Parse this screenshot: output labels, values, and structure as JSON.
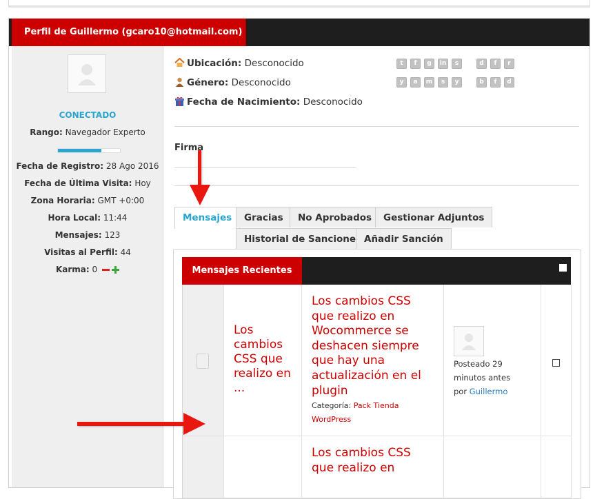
{
  "profile": {
    "header_title": "Perfil de Guillermo (gcaro10@hotmail.com)",
    "status": "CONECTADO",
    "rank_label": "Rango:",
    "rank_value": "Navegador Experto",
    "rank_progress": 0.7,
    "stats": [
      {
        "label": "Fecha de Registro:",
        "value": "28 Ago 2016"
      },
      {
        "label": "Fecha de Última Visita:",
        "value": "Hoy"
      },
      {
        "label": "Zona Horaria:",
        "value": "GMT +0:00"
      },
      {
        "label": "Hora Local:",
        "value": "11:44"
      },
      {
        "label": "Mensajes:",
        "value": "123"
      },
      {
        "label": "Visitas al Perfil:",
        "value": "44"
      }
    ],
    "karma_label": "Karma:",
    "karma_value": "0"
  },
  "info": {
    "location_label": "Ubicación:",
    "location_value": "Desconocido",
    "gender_label": "Género:",
    "gender_value": "Desconocido",
    "birth_label": "Fecha de Nacimiento:",
    "birth_value": "Desconocido",
    "signature_label": "Firma"
  },
  "social_icons": {
    "row1": [
      "t",
      "f",
      "g",
      "in",
      "s",
      "d",
      "f",
      "r"
    ],
    "row2": [
      "y",
      "a",
      "m",
      "s",
      "y",
      "b",
      "f",
      "d"
    ]
  },
  "tabs": {
    "row1": [
      "Mensajes",
      "Gracias",
      "No Aprobados",
      "Gestionar Adjuntos"
    ],
    "row2": [
      "Historial de Sanciones",
      "Añadir Sanción"
    ],
    "active": "Mensajes"
  },
  "posts": {
    "header_title": "Mensajes Recientes",
    "items": [
      {
        "short_title": "Los cambios CSS que realizo en ...",
        "title": "Los cambios CSS que realizo en Wocommerce se deshacen siempre que hay una actualización en el plugin",
        "category_label": "Categoría:",
        "category_value": "Pack Tienda WordPress",
        "posted": "Posteado 29 minutos antes",
        "by_label": "por",
        "author": "Guillermo"
      },
      {
        "title": "Los cambios CSS que realizo en"
      }
    ]
  },
  "colors": {
    "accent_red": "#cc0000",
    "header_dark": "#1e1e1e",
    "link_blue": "#2aa5cf",
    "arrow_red": "#e8170f"
  },
  "icons": [
    "home-icon",
    "user-gender-icon",
    "gift-icon",
    "avatar-placeholder-icon",
    "document-icon",
    "arrow-annotation"
  ]
}
